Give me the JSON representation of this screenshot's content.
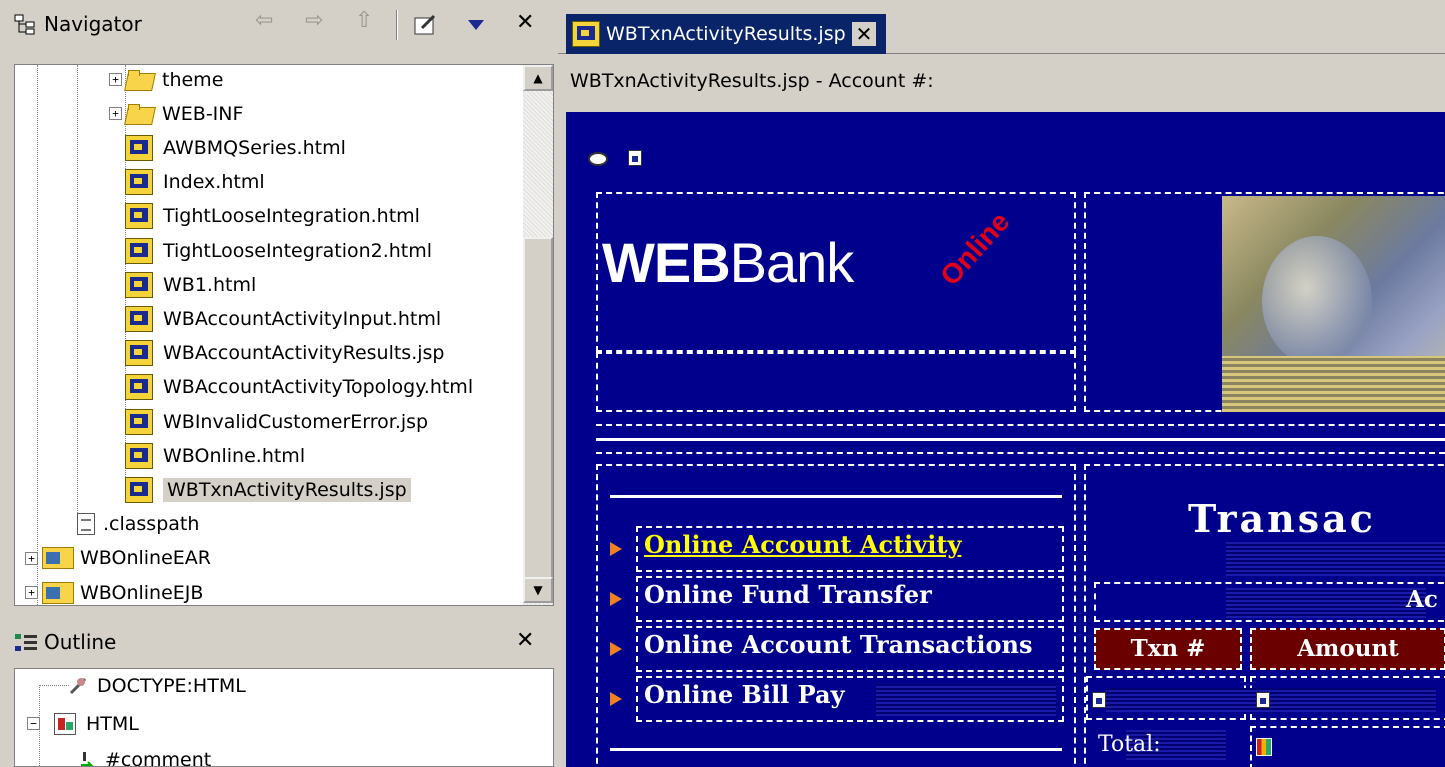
{
  "navigator": {
    "title": "Navigator",
    "tree": [
      {
        "label": "theme",
        "kind": "folder",
        "expandable": true
      },
      {
        "label": "WEB-INF",
        "kind": "folder",
        "expandable": true
      },
      {
        "label": "AWBMQSeries.html",
        "kind": "file"
      },
      {
        "label": "Index.html",
        "kind": "file"
      },
      {
        "label": "TightLooseIntegration.html",
        "kind": "file"
      },
      {
        "label": "TightLooseIntegration2.html",
        "kind": "file"
      },
      {
        "label": "WB1.html",
        "kind": "file"
      },
      {
        "label": "WBAccountActivityInput.html",
        "kind": "file"
      },
      {
        "label": "WBAccountActivityResults.jsp",
        "kind": "file"
      },
      {
        "label": "WBAccountActivityTopology.html",
        "kind": "file"
      },
      {
        "label": "WBInvalidCustomerError.jsp",
        "kind": "file"
      },
      {
        "label": "WBOnline.html",
        "kind": "file"
      },
      {
        "label": "WBTxnActivityResults.jsp",
        "kind": "file",
        "selected": true
      },
      {
        "label": ".classpath",
        "kind": "text"
      },
      {
        "label": "WBOnlineEAR",
        "kind": "project",
        "expandable": true
      },
      {
        "label": "WBOnlineEJB",
        "kind": "project",
        "expandable": true
      }
    ]
  },
  "outline": {
    "title": "Outline",
    "tree": [
      {
        "label": "DOCTYPE:HTML"
      },
      {
        "label": "HTML"
      },
      {
        "label": "#comment"
      }
    ]
  },
  "editor": {
    "tab_label": "WBTxnActivityResults.jsp",
    "subtitle": "WBTxnActivityResults.jsp - Account #:",
    "page": {
      "logo_main": "WEB",
      "logo_bank": "Bank",
      "logo_online": "Online",
      "nav_links": [
        "Online Account Activity",
        "Online Fund Transfer",
        "Online Account Transactions",
        "Online Bill Pay"
      ],
      "heading": "Transac",
      "subheading": "Ac",
      "col_txn": "Txn #",
      "col_amount": "Amount",
      "total_label": "Total:"
    }
  },
  "colors": {
    "page_bg": "#00008c",
    "active_link": "#ffff00",
    "header_cell": "#6a0000",
    "tab_active": "#0a246a"
  }
}
